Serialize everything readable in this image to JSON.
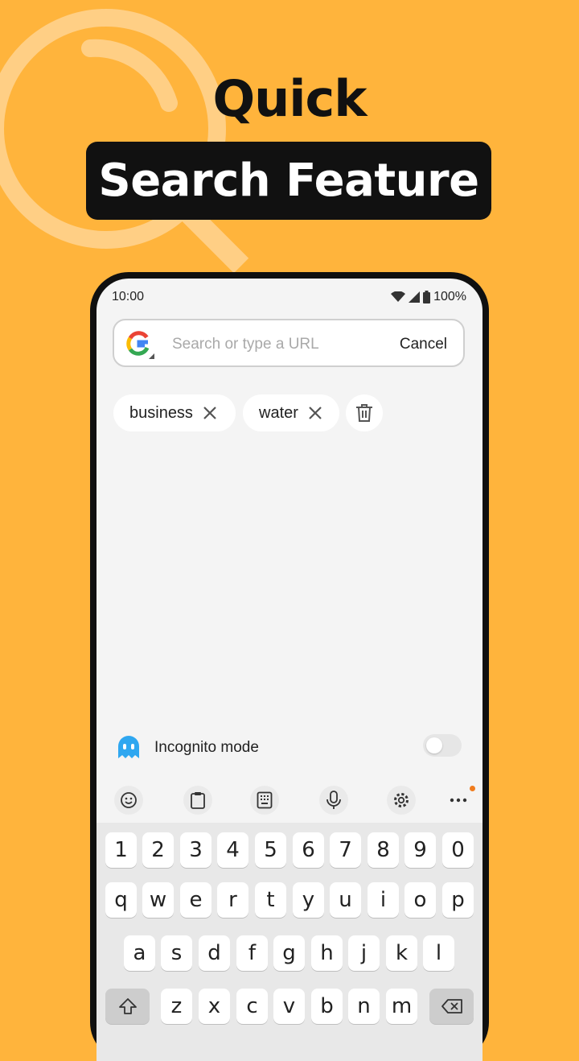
{
  "headline": {
    "line1": "Quick",
    "line2": "Search Feature"
  },
  "status_bar": {
    "time": "10:00",
    "battery": "100%"
  },
  "search": {
    "placeholder": "Search or type a URL",
    "cancel_label": "Cancel"
  },
  "recent_searches": [
    {
      "label": "business"
    },
    {
      "label": "water"
    }
  ],
  "incognito": {
    "label": "Incognito mode",
    "enabled": false
  },
  "keyboard_toolbar": {
    "icons": [
      "emoji-icon",
      "clipboard-icon",
      "keypad-icon",
      "microphone-icon",
      "settings-icon",
      "more-icon"
    ]
  },
  "keyboard": {
    "row_numbers": [
      "1",
      "2",
      "3",
      "4",
      "5",
      "6",
      "7",
      "8",
      "9",
      "0"
    ],
    "row1": [
      "q",
      "w",
      "e",
      "r",
      "t",
      "y",
      "u",
      "i",
      "o",
      "p"
    ],
    "row2": [
      "a",
      "s",
      "d",
      "f",
      "g",
      "h",
      "j",
      "k",
      "l"
    ],
    "row3": [
      "z",
      "x",
      "c",
      "v",
      "b",
      "n",
      "m"
    ]
  },
  "colors": {
    "background": "#FFB43C",
    "banner": "#111111",
    "ghost": "#2FA7F0",
    "notification_dot": "#F07C1E"
  }
}
